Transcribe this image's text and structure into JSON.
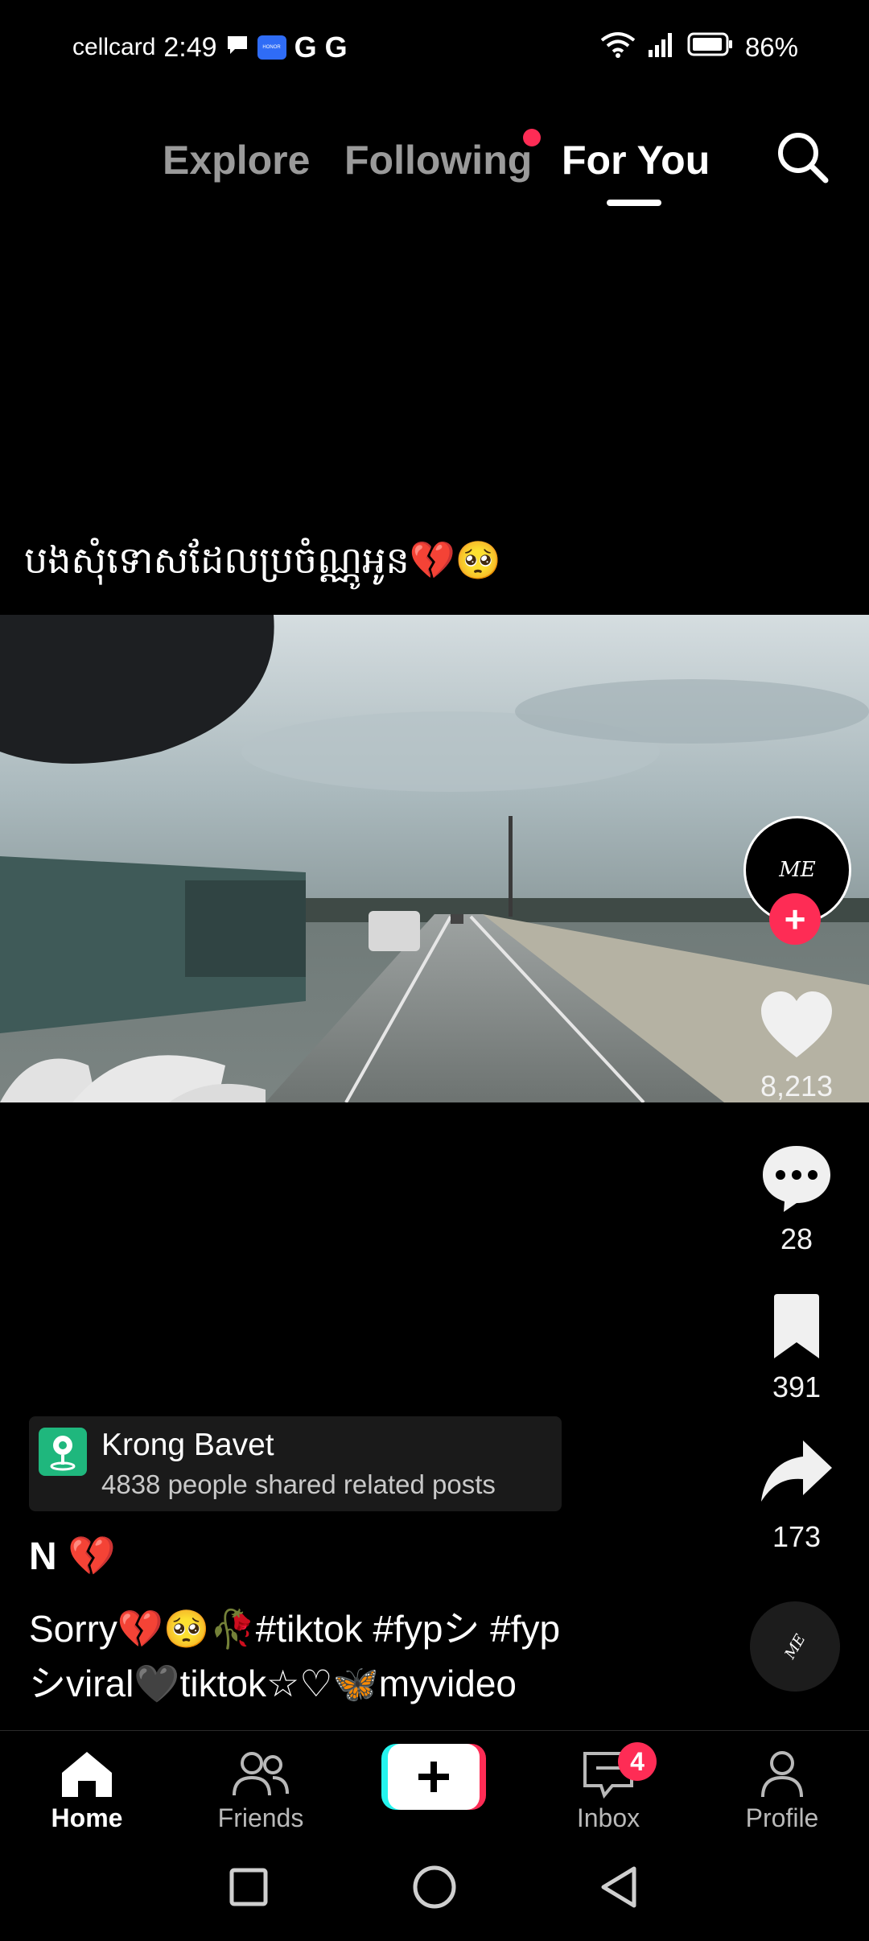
{
  "status_bar": {
    "carrier": "cellcard",
    "time": "2:49",
    "battery": "86%",
    "icons": [
      "message-icon",
      "honor-app-icon",
      "google-icon",
      "google-icon",
      "wifi-icon",
      "signal-icon",
      "battery-icon"
    ],
    "google_glyph": "G"
  },
  "top_tabs": {
    "explore": "Explore",
    "following": "Following",
    "for_you": "For You",
    "active": "For You",
    "following_has_new": true
  },
  "video": {
    "overlay_text": "បងសុំទោសដែលប្រចំណ្ណូអូន💔🥺"
  },
  "creator": {
    "avatar_text": "ME",
    "follow_symbol": "+"
  },
  "actions": {
    "likes": "8,213",
    "comments": "28",
    "saves": "391",
    "shares": "173"
  },
  "location": {
    "name": "Krong Bavet",
    "subtitle": "4838 people shared related posts"
  },
  "post": {
    "author": "N 💔",
    "caption_line1": "Sorry💔🥺🥀#tiktok #fypシ #fyp",
    "caption_line2": "シviral🖤tiktok☆♡🦋myvideo"
  },
  "music_disc": {
    "text": "ME"
  },
  "bottom_nav": {
    "home": "Home",
    "friends": "Friends",
    "inbox": "Inbox",
    "profile": "Profile",
    "inbox_badge": "4",
    "active": "Home"
  },
  "colors": {
    "accent": "#fe2c55",
    "create_left": "#25f4ee",
    "create_right": "#fe2c55",
    "location_icon": "#1fb77d"
  }
}
